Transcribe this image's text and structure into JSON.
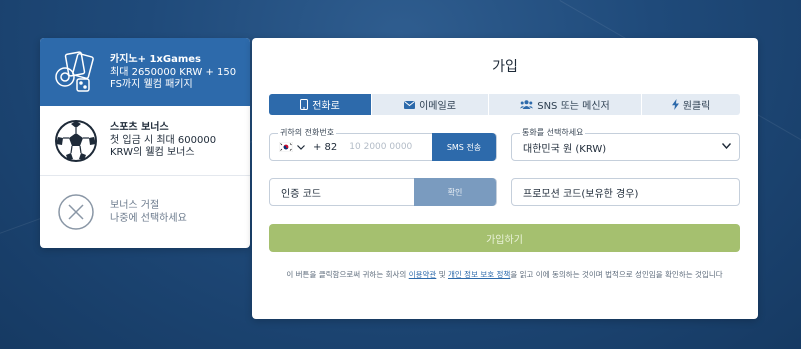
{
  "sidebar": {
    "casino": {
      "title": "카지노+ 1xGames",
      "desc": "최대 2650000 KRW + 150 FS까지 웰컴 패키지"
    },
    "sports": {
      "title": "스포츠 보너스",
      "desc": "첫 입금 시 최대 600000 KRW의 웰컴 보너스"
    },
    "decline": {
      "title": "보너스 거절",
      "desc": "나중에 선택하세요"
    }
  },
  "form": {
    "title": "가입",
    "tabs": [
      {
        "label": "전화로",
        "icon": "phone-icon"
      },
      {
        "label": "이메일로",
        "icon": "envelope-icon"
      },
      {
        "label": "SNS 또는 메신저",
        "icon": "users-icon"
      },
      {
        "label": "원클릭",
        "icon": "lightning-icon"
      }
    ],
    "phone": {
      "label": "귀하의 전화번호",
      "country_code": "+ 82",
      "placeholder": "10 2000 0000",
      "sms_button": "SMS 전송"
    },
    "currency": {
      "label": "통화를 선택하세요",
      "value": "대한민국 원 (KRW)"
    },
    "verification": {
      "placeholder": "인증 코드",
      "confirm_button": "확인"
    },
    "promo": {
      "placeholder": "프로모션 코드(보유한 경우)"
    },
    "register_button": "가입하기",
    "terms": {
      "prefix": "이 버튼을 클릭함으로써 귀하는 회사의 ",
      "link1": "이용약관",
      "middle": " 및 ",
      "link2": "개인 정보 보호 정책",
      "suffix": "을 읽고 이에 동의하는 것이며 법적으로 성인임을 확인하는 것입니다"
    }
  },
  "colors": {
    "accent": "#2d6aab",
    "register": "#a5c06f",
    "background": "#1f4a7a"
  }
}
